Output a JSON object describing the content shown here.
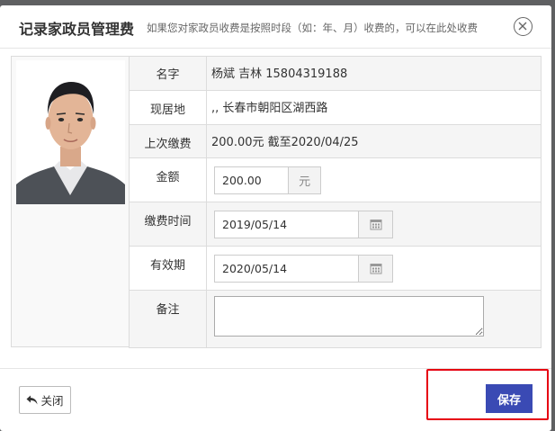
{
  "modal": {
    "title": "记录家政员管理费",
    "subtitle": "如果您对家政员收费是按照时段（如：年、月）收费的，可以在此处收费"
  },
  "form": {
    "name": {
      "label": "名字",
      "value": "杨斌 吉林 15804319188"
    },
    "residence": {
      "label": "现居地",
      "value": ",, 长春市朝阳区湖西路"
    },
    "last_payment": {
      "label": "上次缴费",
      "value": "200.00元 截至2020/04/25"
    },
    "amount": {
      "label": "金额",
      "value": "200.00",
      "unit": "元"
    },
    "payment_time": {
      "label": "缴费时间",
      "value": "2019/05/14",
      "icon": "calendar-icon"
    },
    "valid_until": {
      "label": "有效期",
      "value": "2020/05/14",
      "icon": "calendar-icon"
    },
    "note": {
      "label": "备注",
      "value": ""
    }
  },
  "footer": {
    "close_label": "关闭",
    "save_label": "保存"
  },
  "colors": {
    "primary": "#3a4ab4",
    "highlight": "#e60012",
    "row_shade": "#f5f5f5",
    "border": "#dcdcdc"
  }
}
